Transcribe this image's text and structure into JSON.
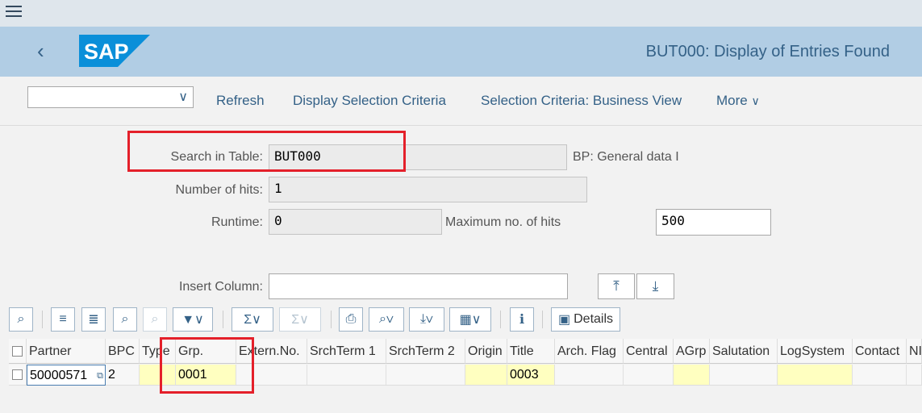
{
  "shell": {
    "app_title": "BUT000: Display of Entries Found",
    "logo_text": "SAP"
  },
  "toolbar": {
    "select_value": "",
    "buttons": [
      "Refresh",
      "Display Selection Criteria",
      "Selection Criteria: Business View",
      "More"
    ]
  },
  "form": {
    "search_label": "Search in Table:",
    "search_value": "BUT000",
    "search_desc": "BP: General data I",
    "hits_label": "Number of hits:",
    "hits_value": "1",
    "runtime_label": "Runtime:",
    "runtime_value": "0",
    "maxhits_label": "Maximum no. of hits",
    "maxhits_value": "500",
    "insert_label": "Insert Column:",
    "insert_value": ""
  },
  "grid_toolbar": {
    "details_label": "Details"
  },
  "table": {
    "columns": [
      "Partner",
      "BPC",
      "Type",
      "Grp.",
      "Extern.No.",
      "SrchTerm 1",
      "SrchTerm 2",
      "Origin",
      "Title",
      "Arch. Flag",
      "Central",
      "AGrp",
      "Salutation",
      "LogSystem",
      "Contact",
      "NI"
    ],
    "rows": [
      [
        "50000571",
        "2",
        "",
        "0001",
        "",
        "",
        "",
        "",
        "0003",
        "",
        "",
        "",
        "",
        "",
        "",
        ""
      ]
    ]
  },
  "colors": {
    "accent": "#346187",
    "shell": "#b1cde4",
    "highlight": "#e4202a",
    "key_cell": "#ffffc0"
  }
}
